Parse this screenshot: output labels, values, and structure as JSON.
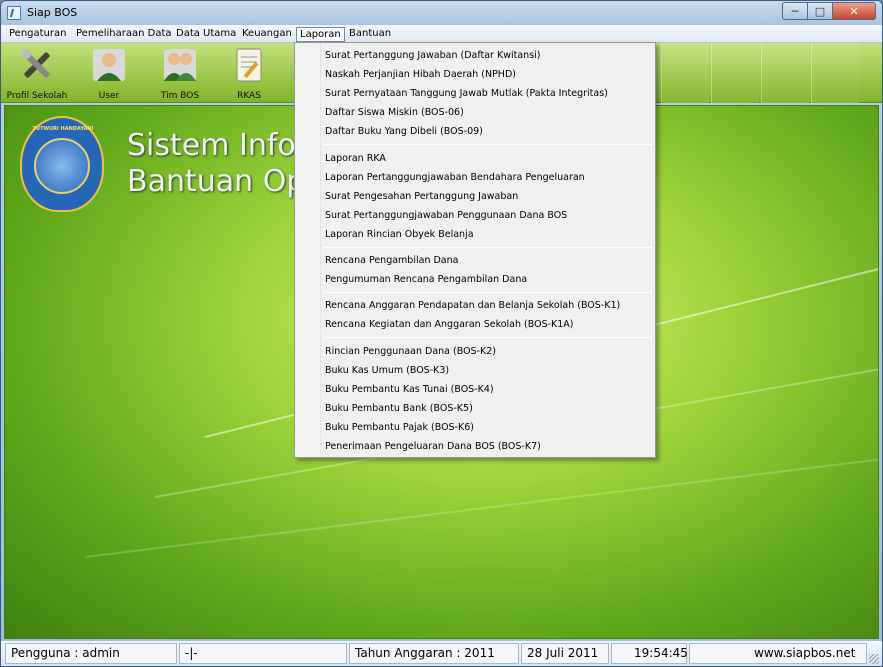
{
  "window": {
    "title": "Siap BOS",
    "minimize": "─",
    "maximize": "□",
    "close": "✕"
  },
  "menubar": {
    "items": [
      {
        "label": "Pengaturan"
      },
      {
        "label": "Pemeliharaan Data"
      },
      {
        "label": "Data Utama"
      },
      {
        "label": "Keuangan"
      },
      {
        "label": "Laporan"
      },
      {
        "label": "Bantuan"
      }
    ]
  },
  "toolbar": {
    "buttons": [
      {
        "label": "Profil Sekolah",
        "icon": "tools-icon"
      },
      {
        "label": "User",
        "icon": "user-icon"
      },
      {
        "label": "Tim BOS",
        "icon": "team-icon"
      },
      {
        "label": "RKAS",
        "icon": "document-icon"
      }
    ]
  },
  "main": {
    "logo_text": "TUTWURI HANDAYANI",
    "title_line1": "Sistem Infor",
    "title_line2": "Bantuan Ope"
  },
  "laporan_menu": {
    "group1": [
      "Surat Pertanggung Jawaban (Daftar Kwitansi)",
      "Naskah Perjanjian Hibah Daerah (NPHD)",
      "Surat Pernyataan Tanggung Jawab Mutlak (Pakta Integritas)",
      "Daftar Siswa Miskin (BOS-06)",
      "Daftar Buku Yang Dibeli (BOS-09)"
    ],
    "group2": [
      "Laporan RKA",
      "Laporan Pertanggungjawaban Bendahara Pengeluaran",
      "Surat Pengesahan Pertanggung Jawaban",
      "Surat Pertanggungjawaban Penggunaan Dana BOS",
      "Laporan Rincian Obyek Belanja"
    ],
    "group3": [
      "Rencana Pengambilan Dana",
      "Pengumuman Rencana Pengambilan Dana"
    ],
    "group4": [
      "Rencana Anggaran Pendapatan dan Belanja Sekolah (BOS-K1)",
      "Rencana Kegiatan dan Anggaran Sekolah (BOS-K1A)"
    ],
    "group5": [
      "Rincian Penggunaan Dana (BOS-K2)",
      "Buku Kas Umum (BOS-K3)",
      "Buku Pembantu Kas Tunai (BOS-K4)",
      "Buku Pembantu Bank (BOS-K5)",
      "Buku Pembantu Pajak (BOS-K6)",
      "Penerimaan  Pengeluaran Dana BOS (BOS-K7)"
    ]
  },
  "status": {
    "user": "Pengguna : admin",
    "placeholder": "-|-",
    "year": "Tahun Anggaran : 2011",
    "date": "28 Juli 2011",
    "time": "19:54:45",
    "website": "www.siapbos.net"
  }
}
